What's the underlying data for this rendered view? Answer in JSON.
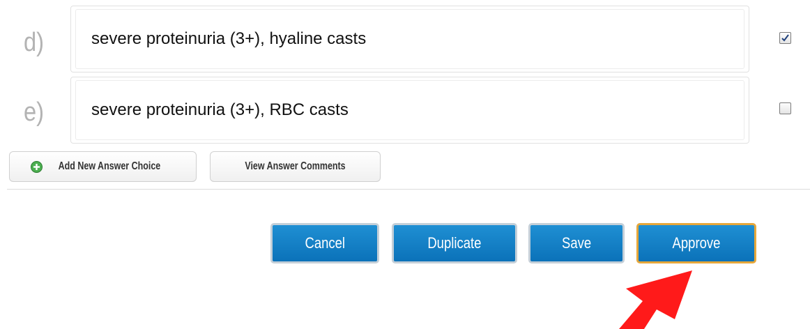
{
  "answer_choices": [
    {
      "letter": "d)",
      "text": "severe proteinuria (3+), hyaline casts",
      "checked": true
    },
    {
      "letter": "e)",
      "text": "severe proteinuria (3+), RBC casts",
      "checked": false
    }
  ],
  "toolbar": {
    "add_choice_label": "Add New Answer Choice",
    "view_comments_label": "View Answer Comments"
  },
  "actions": {
    "cancel_label": "Cancel",
    "duplicate_label": "Duplicate",
    "save_label": "Save",
    "approve_label": "Approve"
  },
  "colors": {
    "action_blue": "#0b72b9",
    "approve_highlight": "#e6a73a",
    "annotation_arrow": "#ff1a1a",
    "add_icon_green": "#4caf50"
  }
}
